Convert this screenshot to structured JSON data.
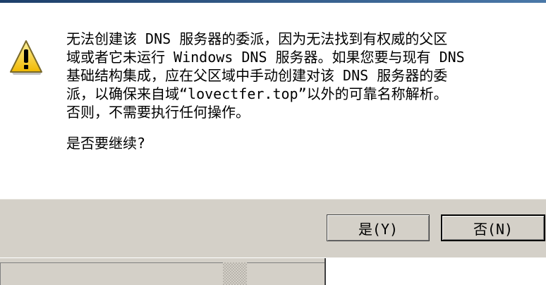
{
  "dialog": {
    "icon": "warning-icon",
    "message": "无法创建该 DNS 服务器的委派，因为无法找到有权威的父区\n域或者它未运行 Windows DNS 服务器。如果您要与现有 DNS\n基础结构集成，应在父区域中手动创建对该 DNS 服务器的委\n派，以确保来自域“lovectfer.top”以外的可靠名称解析。\n否则，不需要执行任何操作。",
    "question": "是否要继续?",
    "buttons": {
      "yes_label": "是(Y)",
      "no_label": "否(N)"
    }
  },
  "colors": {
    "dialog_bg": "#ffffff",
    "button_area_bg": "#d4d0c8",
    "warning_yellow": "#f5c400"
  }
}
